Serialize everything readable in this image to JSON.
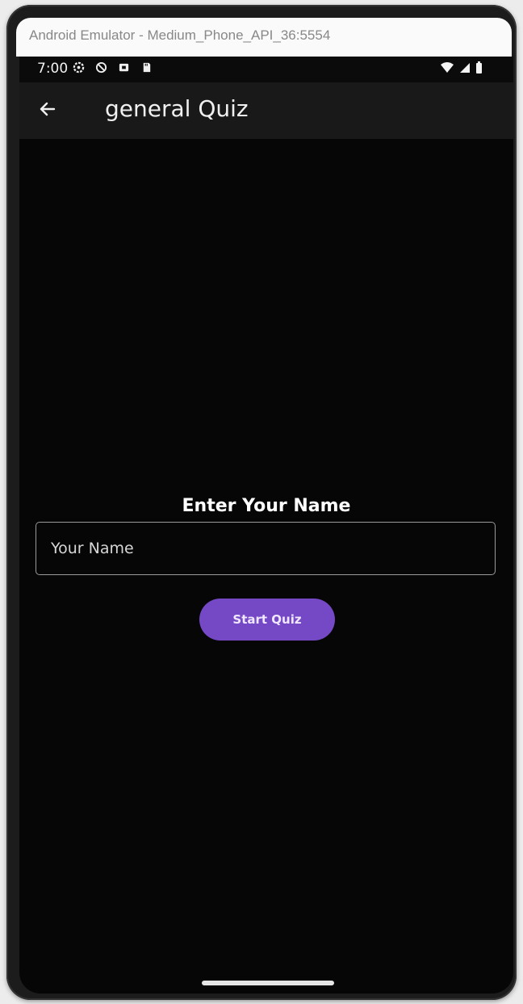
{
  "emulator": {
    "title": "Android Emulator - Medium_Phone_API_36:5554"
  },
  "status_bar": {
    "time": "7:00",
    "left_icons": [
      "settings-icon",
      "block-icon",
      "media-icon",
      "sd-card-icon"
    ],
    "right_icons": [
      "wifi-icon",
      "signal-icon",
      "battery-icon"
    ]
  },
  "app_bar": {
    "back_icon": "arrow-back-icon",
    "title": "general Quiz"
  },
  "form": {
    "heading": "Enter Your Name",
    "name_placeholder": "Your Name",
    "name_value": "",
    "start_button_label": "Start Quiz"
  },
  "colors": {
    "background": "#060606",
    "app_bar": "#191919",
    "accent": "#7549c6"
  }
}
